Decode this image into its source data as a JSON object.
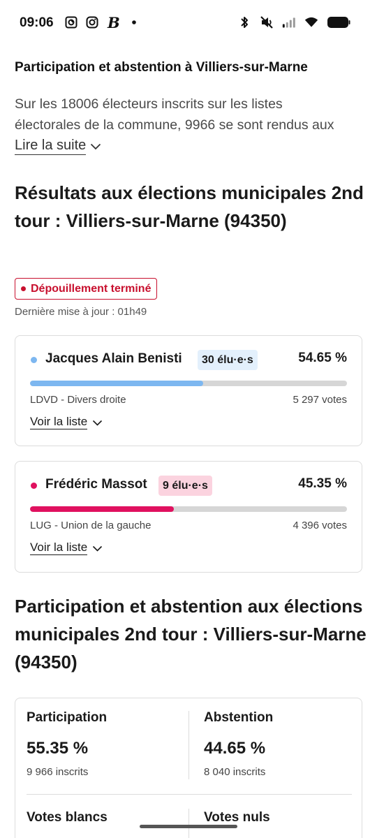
{
  "status_bar": {
    "time": "09:06",
    "left_icons": [
      "notification-app-icon",
      "instagram-icon",
      "b-app-icon",
      "dot-icon"
    ],
    "right_icons": [
      "bluetooth-icon",
      "mute-icon",
      "signal-icon",
      "wifi-icon",
      "battery-icon"
    ]
  },
  "intro": {
    "title": "Participation et abstention à Villiers-sur-Marne",
    "text_line1": "Sur les 18006 électeurs inscrits sur les listes",
    "text_line2": "électorales de la commune, 9966 se sont rendus aux",
    "read_more": "Lire la suite"
  },
  "results": {
    "title": "Résultats aux élections municipales 2nd tour : Villiers-sur-Marne (94350)",
    "status": "Dépouillement terminé",
    "updated": "Dernière mise à jour : 01h49",
    "candidates": [
      {
        "name": "Jacques Alain Benisti",
        "seats": "30 élu·e·s",
        "percent": "54.65 %",
        "share": 0.5465,
        "list": "LDVD - Divers droite",
        "votes": "5 297 votes",
        "see_list": "Voir la liste",
        "color": "#7db7f0",
        "badge_bg": "#e3f0fc",
        "badge_color": "#1a1a1a"
      },
      {
        "name": "Frédéric Massot",
        "seats": "9 élu·e·s",
        "percent": "45.35 %",
        "share": 0.4535,
        "list": "LUG - Union de la gauche",
        "votes": "4 396 votes",
        "see_list": "Voir la liste",
        "color": "#e0115f",
        "badge_bg": "#fbd3df",
        "badge_color": "#1a1a1a"
      }
    ]
  },
  "participation": {
    "title": "Participation et abstention aux élections municipales 2nd tour : Villiers-sur-Marne (94350)",
    "participation_label": "Participation",
    "participation_value": "55.35 %",
    "participation_sub": "9 966 inscrits",
    "abstention_label": "Abstention",
    "abstention_value": "44.65 %",
    "abstention_sub": "8 040 inscrits",
    "blank_label": "Votes blancs",
    "null_label": "Votes nuls"
  }
}
